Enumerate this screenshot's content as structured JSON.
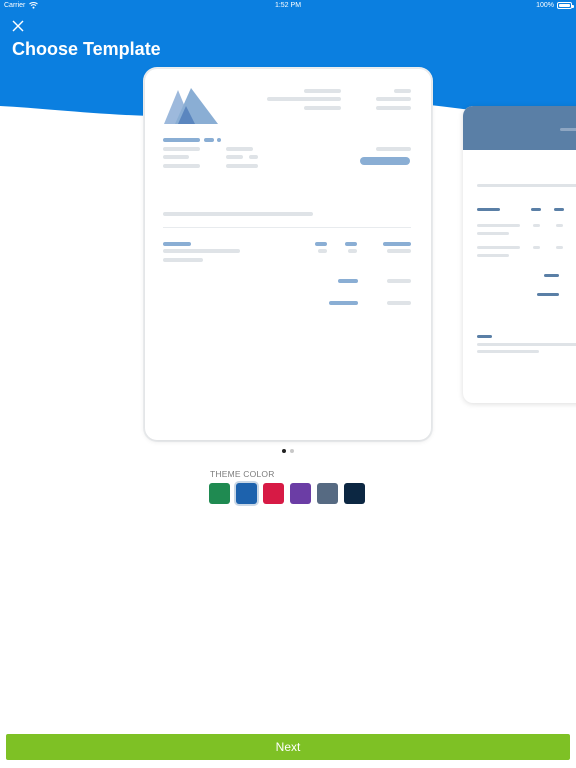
{
  "status_bar": {
    "carrier": "Carrier",
    "time": "1:52 PM",
    "battery": "100%"
  },
  "header": {
    "title": "Choose Template",
    "background_color": "#0b7fe0",
    "close_icon": "close-icon"
  },
  "templates": {
    "count": 2,
    "current_index": 0,
    "items": [
      {
        "name": "template-1",
        "accent": "#8aaed4",
        "selected": true
      },
      {
        "name": "template-2",
        "accent": "#5a7fa6",
        "selected": false
      }
    ]
  },
  "theme": {
    "label": "THEME COLOR",
    "selected_index": 1,
    "colors": [
      "#1f8a51",
      "#1d62ad",
      "#d71a45",
      "#6b3da5",
      "#566a82",
      "#0c2742"
    ]
  },
  "footer": {
    "next_label": "Next",
    "next_color": "#7ec125"
  }
}
